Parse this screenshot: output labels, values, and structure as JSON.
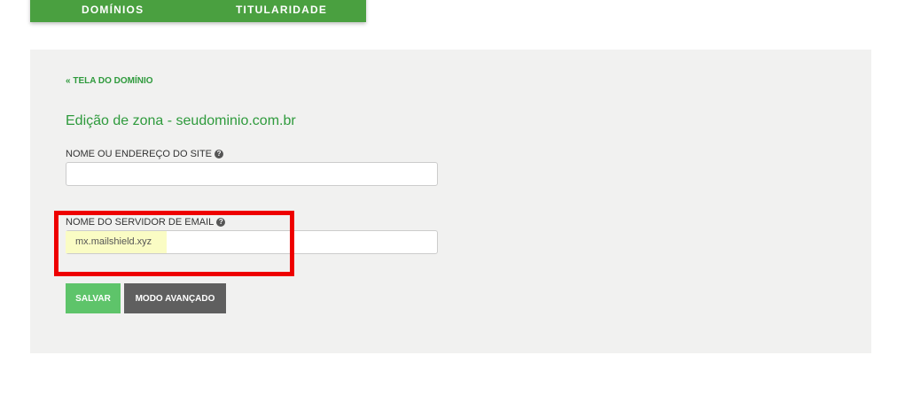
{
  "tabs": [
    "DOMÍNIOS",
    "TITULARIDADE"
  ],
  "back_link": "« TELA DO DOMÍNIO",
  "title": "Edição de zona - seudominio.com.br",
  "help_glyph": "?",
  "site_field": {
    "label": "NOME OU ENDEREÇO DO SITE",
    "value": ""
  },
  "email_field": {
    "label": "NOME DO SERVIDOR DE EMAIL",
    "value": "mx.mailshield.xyz"
  },
  "buttons": {
    "save": "SALVAR",
    "advanced": "MODO AVANÇADO"
  },
  "colors": {
    "brand_green": "#4aa040",
    "link_green": "#2e9a3c",
    "save_button": "#5ec46a",
    "advanced_button": "#5f5f5f",
    "highlight_box": "#ee0000"
  }
}
